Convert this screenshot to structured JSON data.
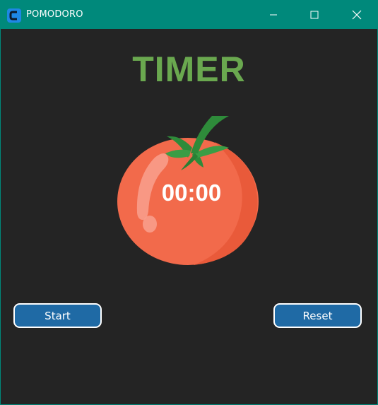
{
  "window": {
    "title": "POMODORO",
    "accent_color": "#00897b",
    "controls": {
      "minimize_icon": "minimize-icon",
      "maximize_icon": "maximize-icon",
      "close_icon": "close-icon"
    }
  },
  "main": {
    "heading": "TIMER",
    "heading_color": "#6aa84f",
    "timer": "00:00",
    "tomato_icon": "tomato-icon",
    "start_label": "Start",
    "reset_label": "Reset",
    "button_color": "#1f6aa5"
  }
}
